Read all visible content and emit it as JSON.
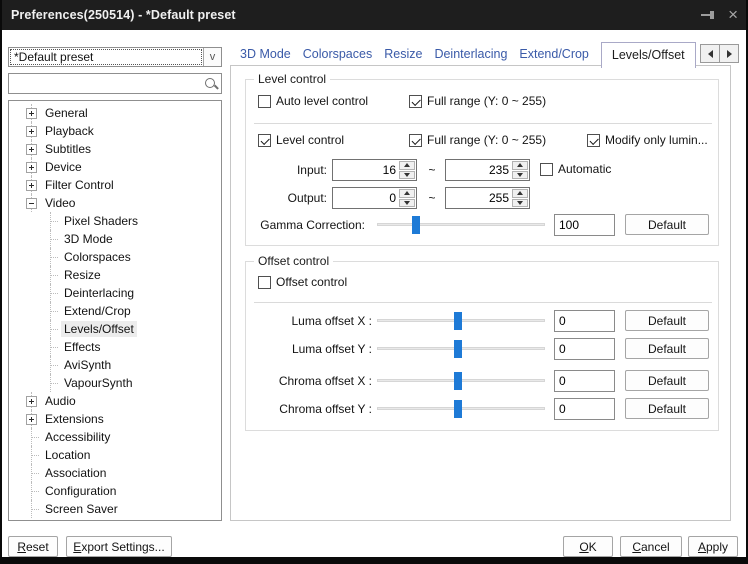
{
  "colors": {
    "accent": "#1e7ad6",
    "tab_link": "#3a5aa8",
    "titlebar": "#1e1e1e",
    "selection": "#ececec"
  },
  "window": {
    "title": "Preferences(250514) - *Default preset"
  },
  "preset": {
    "value": "*Default preset",
    "arrow_char": "v"
  },
  "search": {
    "value": "",
    "placeholder": ""
  },
  "tree": {
    "items": [
      {
        "label": "General",
        "level": 0,
        "expander": "plus"
      },
      {
        "label": "Playback",
        "level": 0,
        "expander": "plus"
      },
      {
        "label": "Subtitles",
        "level": 0,
        "expander": "plus"
      },
      {
        "label": "Device",
        "level": 0,
        "expander": "plus"
      },
      {
        "label": "Filter Control",
        "level": 0,
        "expander": "plus"
      },
      {
        "label": "Video",
        "level": 0,
        "expander": "minus"
      },
      {
        "label": "Pixel Shaders",
        "level": 1
      },
      {
        "label": "3D Mode",
        "level": 1
      },
      {
        "label": "Colorspaces",
        "level": 1
      },
      {
        "label": "Resize",
        "level": 1
      },
      {
        "label": "Deinterlacing",
        "level": 1
      },
      {
        "label": "Extend/Crop",
        "level": 1
      },
      {
        "label": "Levels/Offset",
        "level": 1,
        "selected": true
      },
      {
        "label": "Effects",
        "level": 1
      },
      {
        "label": "AviSynth",
        "level": 1
      },
      {
        "label": "VapourSynth",
        "level": 1
      },
      {
        "label": "Audio",
        "level": 0,
        "expander": "plus"
      },
      {
        "label": "Extensions",
        "level": 0,
        "expander": "plus"
      },
      {
        "label": "Accessibility",
        "level": 0
      },
      {
        "label": "Location",
        "level": 0
      },
      {
        "label": "Association",
        "level": 0
      },
      {
        "label": "Configuration",
        "level": 0
      },
      {
        "label": "Screen Saver",
        "level": 0
      }
    ]
  },
  "tabs": {
    "items": [
      {
        "label": "3D Mode"
      },
      {
        "label": "Colorspaces"
      },
      {
        "label": "Resize"
      },
      {
        "label": "Deinterlacing"
      },
      {
        "label": "Extend/Crop"
      },
      {
        "label": "Levels/Offset",
        "active": true
      }
    ]
  },
  "level_control": {
    "group_label": "Level control",
    "auto_level": {
      "label": "Auto level control",
      "checked": false
    },
    "full_range_top": {
      "label": "Full range (Y: 0 ~ 255)",
      "checked": true
    },
    "level": {
      "label": "Level control",
      "checked": true
    },
    "full_range": {
      "label": "Full range (Y: 0 ~ 255)",
      "checked": true
    },
    "modify_luma": {
      "label": "Modify only lumin...",
      "checked": true
    },
    "input": {
      "label": "Input:",
      "from": "16",
      "tilde": "~",
      "to": "235",
      "automatic": {
        "label": "Automatic",
        "checked": false
      }
    },
    "output": {
      "label": "Output:",
      "from": "0",
      "tilde": "~",
      "to": "255"
    },
    "gamma": {
      "label": "Gamma Correction:",
      "value": "100",
      "default_label": "Default",
      "slider_pos_pct": 23
    }
  },
  "offset_control": {
    "group_label": "Offset control",
    "enable": {
      "label": "Offset control",
      "checked": false
    },
    "rows": [
      {
        "label": "Luma offset X :",
        "value": "0",
        "default_label": "Default",
        "slider_pos_pct": 48
      },
      {
        "label": "Luma offset Y :",
        "value": "0",
        "default_label": "Default",
        "slider_pos_pct": 48
      },
      {
        "label": "Chroma offset X :",
        "value": "0",
        "default_label": "Default",
        "slider_pos_pct": 48
      },
      {
        "label": "Chroma offset Y :",
        "value": "0",
        "default_label": "Default",
        "slider_pos_pct": 48
      }
    ]
  },
  "footer": {
    "reset": "Reset",
    "export": "Export Settings...",
    "ok": "OK",
    "cancel": "Cancel",
    "apply": "Apply"
  }
}
